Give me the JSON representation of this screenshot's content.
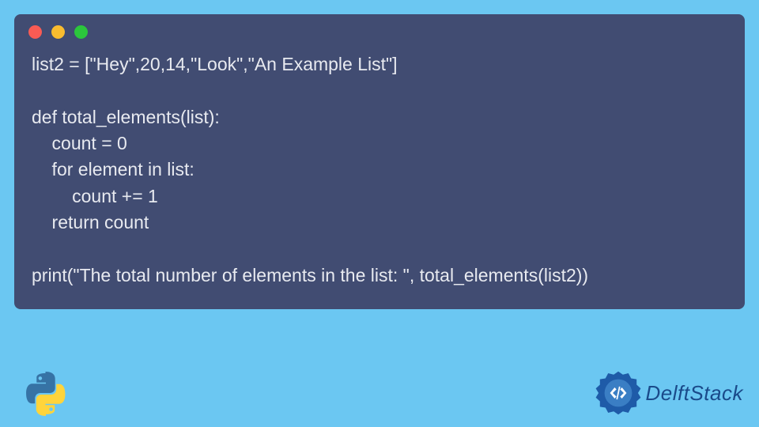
{
  "code": {
    "line1": "list2 = [\"Hey\",20,14,\"Look\",\"An Example List\"]",
    "line2": "",
    "line3": "def total_elements(list):",
    "line4": "    count = 0",
    "line5": "    for element in list:",
    "line6": "        count += 1",
    "line7": "    return count",
    "line8": "",
    "line9": "print(\"The total number of elements in the list: \", total_elements(list2))"
  },
  "brand": {
    "name": "DelftStack"
  }
}
